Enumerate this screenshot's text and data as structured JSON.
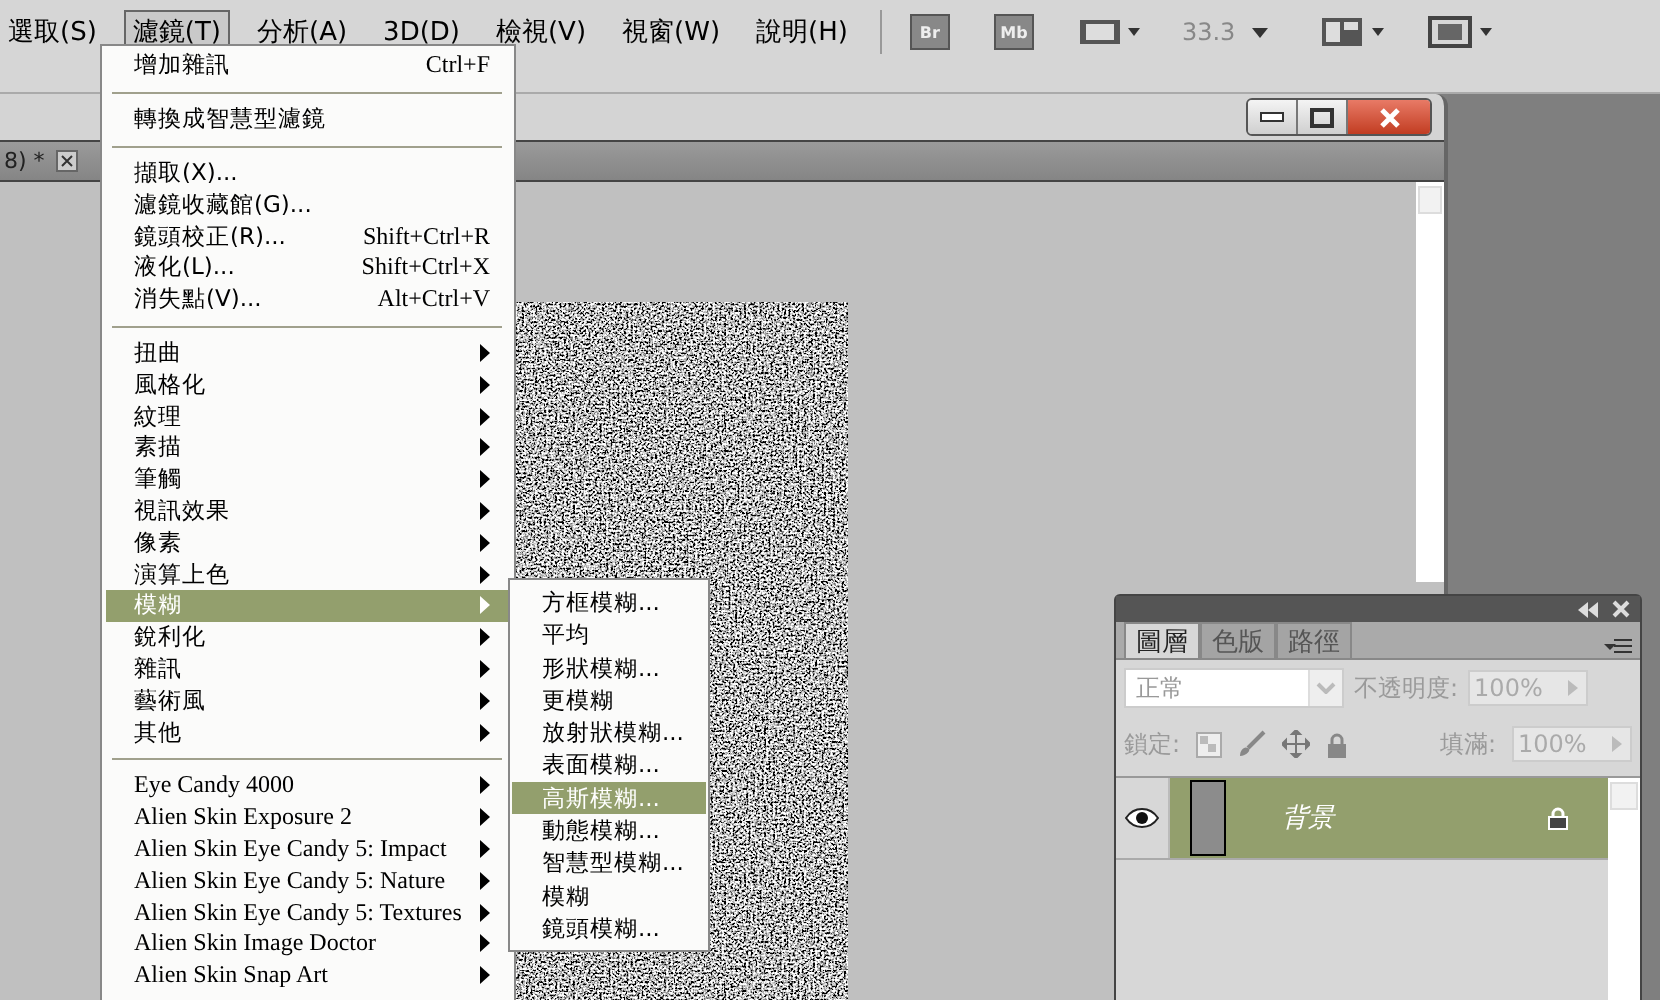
{
  "menubar": {
    "items": [
      {
        "label": "選取(S)",
        "selected": false
      },
      {
        "label": "濾鏡(T)",
        "selected": true
      },
      {
        "label": "分析(A)",
        "selected": false
      },
      {
        "label": "3D(D)",
        "selected": false
      },
      {
        "label": "檢視(V)",
        "selected": false
      },
      {
        "label": "視窗(W)",
        "selected": false
      },
      {
        "label": "說明(H)",
        "selected": false
      }
    ],
    "app_buttons": [
      "Br",
      "Mb"
    ],
    "zoom": "33.3"
  },
  "document": {
    "tab_label": "8) *"
  },
  "filter_menu": {
    "items": [
      {
        "kind": "item",
        "label": "增加雜訊",
        "shortcut": "Ctrl+F",
        "selected": false
      },
      {
        "kind": "separator"
      },
      {
        "kind": "item",
        "label": "轉換成智慧型濾鏡",
        "selected": false
      },
      {
        "kind": "separator"
      },
      {
        "kind": "item",
        "label": "擷取(X)...",
        "selected": false
      },
      {
        "kind": "item",
        "label": "濾鏡收藏館(G)...",
        "selected": false
      },
      {
        "kind": "item",
        "label": "鏡頭校正(R)...",
        "shortcut": "Shift+Ctrl+R",
        "selected": false
      },
      {
        "kind": "item",
        "label": "液化(L)...",
        "shortcut": "Shift+Ctrl+X",
        "selected": false
      },
      {
        "kind": "item",
        "label": "消失點(V)...",
        "shortcut": "Alt+Ctrl+V",
        "selected": false
      },
      {
        "kind": "separator"
      },
      {
        "kind": "submenu",
        "label": "扭曲",
        "selected": false
      },
      {
        "kind": "submenu",
        "label": "風格化",
        "selected": false
      },
      {
        "kind": "submenu",
        "label": "紋理",
        "selected": false
      },
      {
        "kind": "submenu",
        "label": "素描",
        "selected": false
      },
      {
        "kind": "submenu",
        "label": "筆觸",
        "selected": false
      },
      {
        "kind": "submenu",
        "label": "視訊效果",
        "selected": false
      },
      {
        "kind": "submenu",
        "label": "像素",
        "selected": false
      },
      {
        "kind": "submenu",
        "label": "演算上色",
        "selected": false
      },
      {
        "kind": "submenu",
        "label": "模糊",
        "selected": true
      },
      {
        "kind": "submenu",
        "label": "銳利化",
        "selected": false
      },
      {
        "kind": "submenu",
        "label": "雜訊",
        "selected": false
      },
      {
        "kind": "submenu",
        "label": "藝術風",
        "selected": false
      },
      {
        "kind": "submenu",
        "label": "其他",
        "selected": false
      },
      {
        "kind": "separator"
      },
      {
        "kind": "plugin",
        "label": "Eye Candy 4000",
        "selected": false
      },
      {
        "kind": "plugin",
        "label": "Alien Skin Exposure 2",
        "selected": false
      },
      {
        "kind": "plugin",
        "label": "Alien Skin Eye Candy 5: Impact",
        "selected": false
      },
      {
        "kind": "plugin",
        "label": "Alien Skin Eye Candy 5: Nature",
        "selected": false
      },
      {
        "kind": "plugin",
        "label": "Alien Skin Eye Candy 5: Textures",
        "selected": false
      },
      {
        "kind": "plugin",
        "label": "Alien Skin Image Doctor",
        "selected": false
      },
      {
        "kind": "plugin",
        "label": "Alien Skin Snap Art",
        "selected": false
      }
    ]
  },
  "blur_submenu": {
    "items": [
      {
        "label": "方框模糊...",
        "selected": false
      },
      {
        "label": "平均",
        "selected": false
      },
      {
        "label": "形狀模糊...",
        "selected": false
      },
      {
        "label": "更模糊",
        "selected": false
      },
      {
        "label": "放射狀模糊...",
        "selected": false
      },
      {
        "label": "表面模糊...",
        "selected": false
      },
      {
        "label": "高斯模糊...",
        "selected": true
      },
      {
        "label": "動態模糊...",
        "selected": false
      },
      {
        "label": "智慧型模糊...",
        "selected": false
      },
      {
        "label": "模糊",
        "selected": false
      },
      {
        "label": "鏡頭模糊...",
        "selected": false
      }
    ]
  },
  "layers_panel": {
    "tabs": [
      {
        "label": "圖層",
        "selected": true
      },
      {
        "label": "色版",
        "selected": false
      },
      {
        "label": "路徑",
        "selected": false
      }
    ],
    "blend_mode": "正常",
    "opacity_label": "不透明度:",
    "opacity": "100%",
    "lock_label": "鎖定:",
    "fill_label": "填滿:",
    "fill": "100%",
    "controls_disabled": true,
    "layers": [
      {
        "name": "背景",
        "visible": true,
        "locked": true,
        "selected": true
      }
    ]
  }
}
